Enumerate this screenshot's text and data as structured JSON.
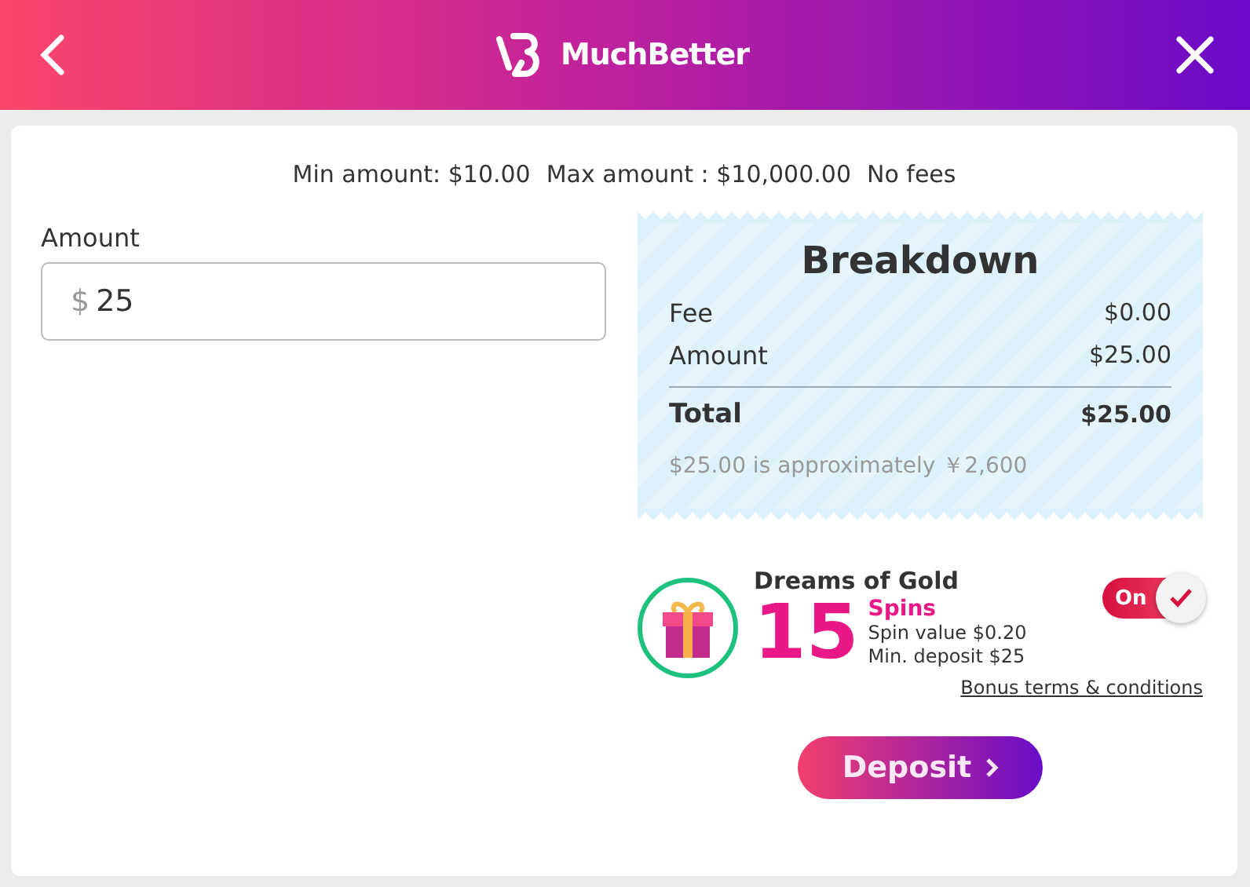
{
  "header": {
    "brand": "MuchBetter"
  },
  "limits": [
    "Min amount: $10.00",
    "Max amount : $10,000.00",
    "No fees"
  ],
  "amount": {
    "label": "Amount",
    "currency": "$",
    "value": "25"
  },
  "breakdown": {
    "title": "Breakdown",
    "rows": [
      {
        "label": "Fee",
        "value": "$0.00",
        "kind": "line"
      },
      {
        "label": "Amount",
        "value": "$25.00",
        "kind": "line"
      },
      {
        "label": "Total",
        "value": "$25.00",
        "kind": "total"
      }
    ],
    "note": "$25.00 is approximately ￥2,600"
  },
  "bonus": {
    "name": "Dreams of Gold",
    "count": "15",
    "unit": "Spins",
    "details": [
      "Spin value $0.20",
      "Min. deposit $25"
    ],
    "toggle_label": "On",
    "on": true,
    "terms": "Bonus terms & conditions"
  },
  "deposit": {
    "label": "Deposit"
  }
}
